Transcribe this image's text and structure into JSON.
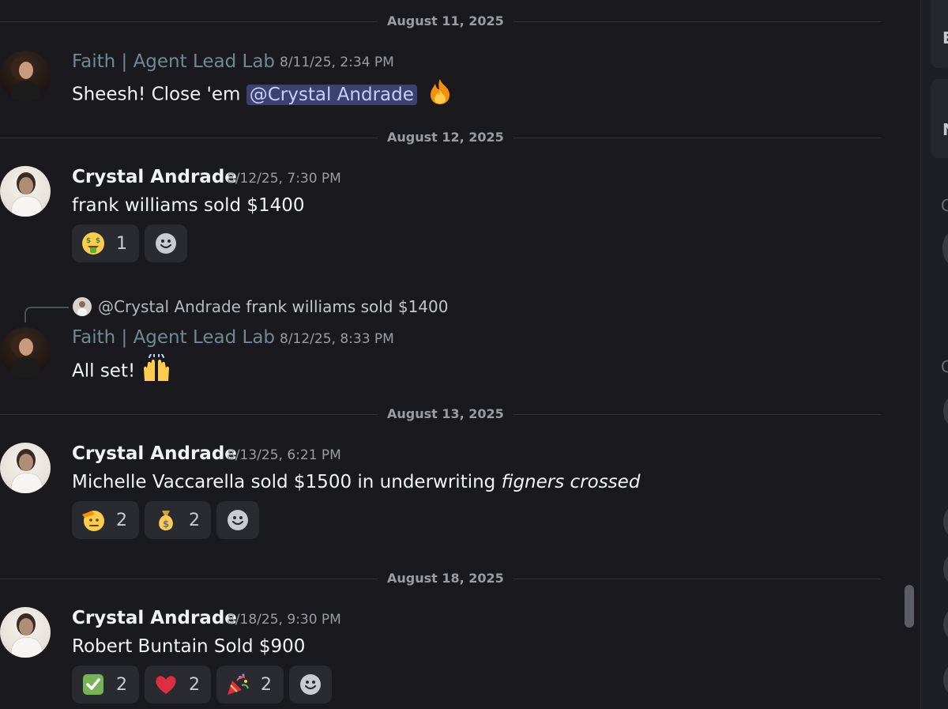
{
  "dates": [
    "August 11, 2025",
    "August 12, 2025",
    "August 13, 2025",
    "August 18, 2025"
  ],
  "m1": {
    "author": "Faith | Agent Lead Lab",
    "time": "8/11/25, 2:34 PM",
    "text": "Sheesh! Close 'em ",
    "mention": "@Crystal Andrade"
  },
  "m2": {
    "author": "Crystal Andrade",
    "time": "8/12/25, 7:30 PM",
    "text": "frank williams sold $1400",
    "reactions": [
      {
        "icon": "money-mouth-face",
        "count": "1"
      }
    ]
  },
  "m3": {
    "reply_name": "@Crystal Andrade",
    "reply_text": "frank williams sold $1400",
    "author": "Faith | Agent Lead Lab",
    "time": "8/12/25, 8:33 PM",
    "text": "All set! "
  },
  "m4": {
    "author": "Crystal Andrade",
    "time": "8/13/25, 6:21 PM",
    "text": "Michelle Vaccarella sold $1500 in underwriting ",
    "italic": "figners crossed",
    "reactions": [
      {
        "icon": "saluting-face",
        "count": "2"
      },
      {
        "icon": "money-bag",
        "count": "2"
      }
    ]
  },
  "m5": {
    "author": "Crystal Andrade",
    "time": "8/18/25, 9:30 PM",
    "text": "Robert Buntain Sold $900",
    "reactions": [
      {
        "icon": "check-mark-button",
        "count": "2"
      },
      {
        "icon": "red-heart",
        "count": "2"
      },
      {
        "icon": "party-popper",
        "count": "2"
      }
    ]
  },
  "sidebar": {
    "frag1": "E",
    "frag2": "N",
    "frag3": "C",
    "frag4": "C"
  }
}
